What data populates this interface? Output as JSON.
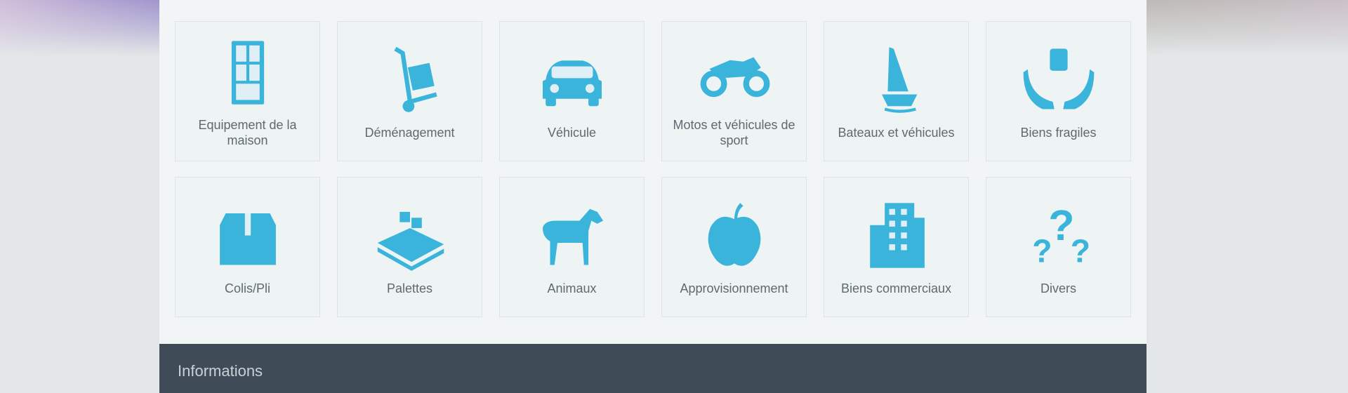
{
  "categories": [
    {
      "label": "Equipement de la maison",
      "icon": "cabinet-icon"
    },
    {
      "label": "Déménagement",
      "icon": "hand-truck-icon"
    },
    {
      "label": "Véhicule",
      "icon": "car-icon"
    },
    {
      "label": "Motos et véhicules de sport",
      "icon": "motorcycle-icon"
    },
    {
      "label": "Bateaux et véhicules",
      "icon": "boat-icon"
    },
    {
      "label": "Biens fragiles",
      "icon": "hands-care-icon"
    },
    {
      "label": "Colis/Pli",
      "icon": "package-icon"
    },
    {
      "label": "Palettes",
      "icon": "pallet-icon"
    },
    {
      "label": "Animaux",
      "icon": "horse-icon"
    },
    {
      "label": "Approvisionnement",
      "icon": "apple-icon"
    },
    {
      "label": "Biens commerciaux",
      "icon": "building-icon"
    },
    {
      "label": "Divers",
      "icon": "question-marks-icon"
    }
  ],
  "info_bar": {
    "title": "Informations"
  },
  "colors": {
    "accent": "#3ab4db",
    "info_bar": "#3f4b56",
    "panel": "#f2f5f6"
  }
}
